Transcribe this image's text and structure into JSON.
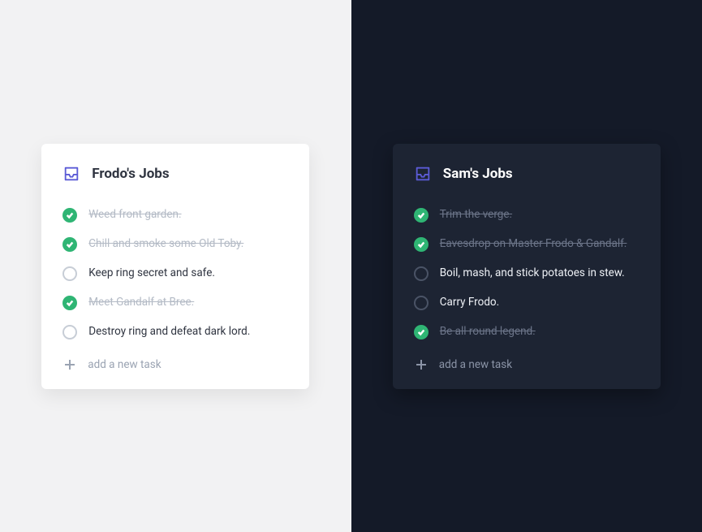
{
  "cards": [
    {
      "title": "Frodo's Jobs",
      "theme": "light",
      "add_label": "add a new task",
      "tasks": [
        {
          "text": "Weed front garden.",
          "done": true
        },
        {
          "text": "Chill and smoke some Old Toby.",
          "done": true
        },
        {
          "text": "Keep ring secret and safe.",
          "done": false
        },
        {
          "text": "Meet Gandalf at Bree.",
          "done": true
        },
        {
          "text": "Destroy ring and defeat dark lord.",
          "done": false
        }
      ]
    },
    {
      "title": "Sam's Jobs",
      "theme": "dark",
      "add_label": "add a new task",
      "tasks": [
        {
          "text": "Trim the verge.",
          "done": true
        },
        {
          "text": "Eavesdrop on Master Frodo & Gandalf.",
          "done": true
        },
        {
          "text": "Boil, mash, and stick potatoes in stew.",
          "done": false
        },
        {
          "text": "Carry Frodo.",
          "done": false
        },
        {
          "text": "Be all round legend.",
          "done": true
        }
      ]
    }
  ]
}
